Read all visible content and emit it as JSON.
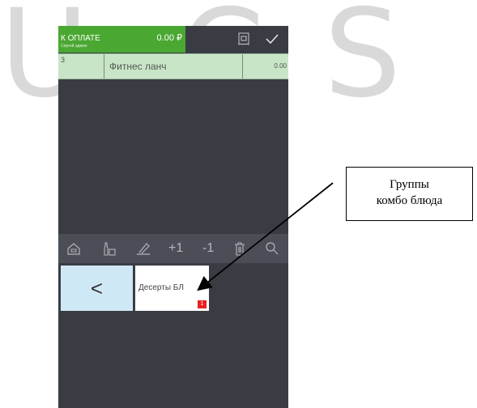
{
  "watermark": {
    "letters": [
      "U",
      "C",
      "S"
    ]
  },
  "header": {
    "pay_label": "К ОПЛАТЕ",
    "user": "Сергей админ",
    "amount": "0.00 ₽"
  },
  "order": {
    "rows": [
      {
        "qty": "3",
        "name": "Фитнес ланч",
        "price": "0.00"
      }
    ]
  },
  "toolbar": {
    "items": [
      {
        "icon": "home-icon"
      },
      {
        "icon": "bottle-icon"
      },
      {
        "icon": "pencil-icon"
      },
      {
        "label": "+1"
      },
      {
        "label": "-1"
      },
      {
        "icon": "trash-icon"
      },
      {
        "icon": "search-icon"
      }
    ]
  },
  "menu": {
    "back_label": "<",
    "tiles": [
      {
        "name": "Десерты БЛ",
        "badge": "1"
      }
    ]
  },
  "callout": {
    "line1": "Группы",
    "line2": "комбо блюда"
  },
  "colors": {
    "accent": "#4aa832",
    "order_row": "#c8e6c7",
    "badge": "#e8201f",
    "back_button": "#cfe8f6"
  }
}
